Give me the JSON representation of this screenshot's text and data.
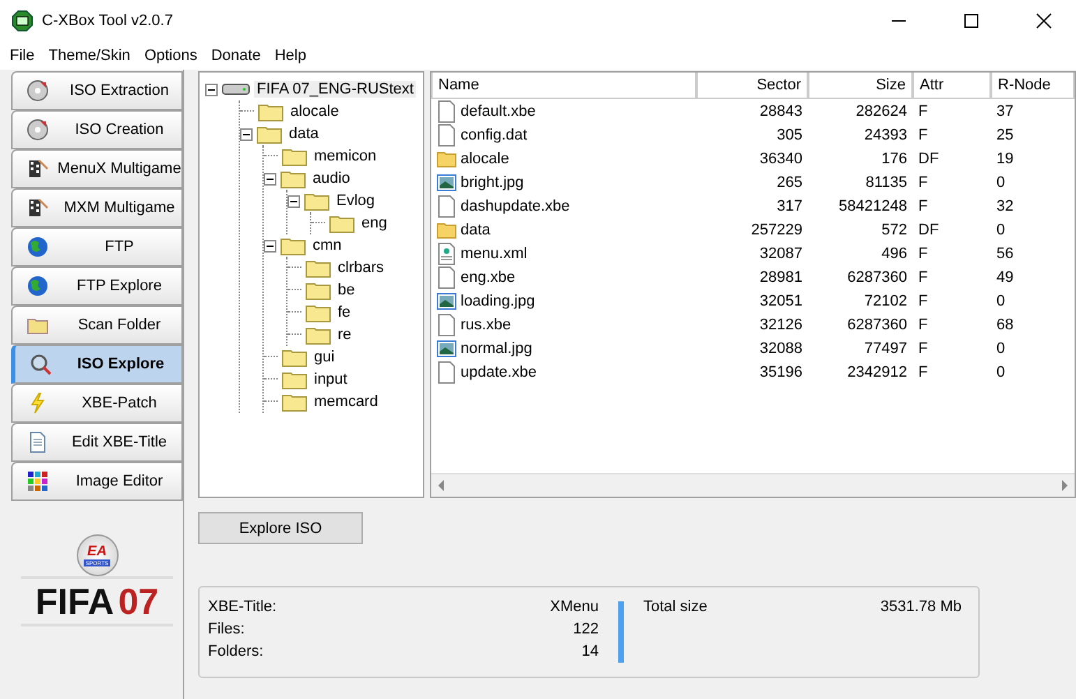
{
  "window": {
    "title": "C-XBox Tool v2.0.7"
  },
  "menu": [
    "File",
    "Theme/Skin",
    "Options",
    "Donate",
    "Help"
  ],
  "sidebar": {
    "items": [
      {
        "label": "ISO Extraction",
        "kind": "disc",
        "selected": false
      },
      {
        "label": "ISO Creation",
        "kind": "disc",
        "selected": false
      },
      {
        "label": "MenuX Multigame",
        "kind": "flag",
        "selected": false
      },
      {
        "label": "MXM Multigame",
        "kind": "flag",
        "selected": false
      },
      {
        "label": "FTP",
        "kind": "globe",
        "selected": false
      },
      {
        "label": "FTP Explore",
        "kind": "globe",
        "selected": false
      },
      {
        "label": "Scan Folder",
        "kind": "folder",
        "selected": false
      },
      {
        "label": "ISO Explore",
        "kind": "search",
        "selected": true
      },
      {
        "label": "XBE-Patch",
        "kind": "bolt",
        "selected": false
      },
      {
        "label": "Edit XBE-Title",
        "kind": "doc",
        "selected": false
      },
      {
        "label": "Image Editor",
        "kind": "palette",
        "selected": false
      }
    ]
  },
  "logo": {
    "badge_top": "EA",
    "badge_bottom": "SPORTS",
    "title": "FIFA",
    "year": "07"
  },
  "tree": {
    "label": "FIFA 07_ENG-RUStext",
    "expanded": true,
    "children": [
      {
        "label": "alocale"
      },
      {
        "label": "data",
        "expanded": true,
        "children": [
          {
            "label": "memicon"
          },
          {
            "label": "audio",
            "expanded": true,
            "children": [
              {
                "label": "Evlog",
                "expanded": true,
                "children": [
                  {
                    "label": "eng"
                  }
                ]
              }
            ]
          },
          {
            "label": "cmn",
            "expanded": true,
            "children": [
              {
                "label": "clrbars"
              },
              {
                "label": "be"
              },
              {
                "label": "fe"
              },
              {
                "label": "re"
              }
            ]
          },
          {
            "label": "gui"
          },
          {
            "label": "input"
          },
          {
            "label": "memcard"
          }
        ]
      }
    ]
  },
  "table": {
    "columns": [
      "Name",
      "Sector",
      "Size",
      "Attr",
      "R-Node"
    ],
    "rows": [
      {
        "kind": "file",
        "cells": [
          "default.xbe",
          "28843",
          "282624",
          "F",
          "37"
        ]
      },
      {
        "kind": "file",
        "cells": [
          "config.dat",
          "305",
          "24393",
          "F",
          "25"
        ]
      },
      {
        "kind": "folder",
        "cells": [
          "alocale",
          "36340",
          "176",
          "DF",
          "19"
        ]
      },
      {
        "kind": "image",
        "cells": [
          "bright.jpg",
          "265",
          "81135",
          "F",
          "0"
        ]
      },
      {
        "kind": "file",
        "cells": [
          "dashupdate.xbe",
          "317",
          "58421248",
          "F",
          "32"
        ]
      },
      {
        "kind": "folder",
        "cells": [
          "data",
          "257229",
          "572",
          "DF",
          "0"
        ]
      },
      {
        "kind": "xml",
        "cells": [
          "menu.xml",
          "32087",
          "496",
          "F",
          "56"
        ]
      },
      {
        "kind": "file",
        "cells": [
          "eng.xbe",
          "28981",
          "6287360",
          "F",
          "49"
        ]
      },
      {
        "kind": "image",
        "cells": [
          "loading.jpg",
          "32051",
          "72102",
          "F",
          "0"
        ]
      },
      {
        "kind": "file",
        "cells": [
          "rus.xbe",
          "32126",
          "6287360",
          "F",
          "68"
        ]
      },
      {
        "kind": "image",
        "cells": [
          "normal.jpg",
          "32088",
          "77497",
          "F",
          "0"
        ]
      },
      {
        "kind": "file",
        "cells": [
          "update.xbe",
          "35196",
          "2342912",
          "F",
          "0"
        ]
      }
    ]
  },
  "explore_button": "Explore ISO",
  "info": {
    "left": [
      {
        "label": "XBE-Title:",
        "value": "XMenu"
      },
      {
        "label": "Files:",
        "value": "122"
      },
      {
        "label": "Folders:",
        "value": "14"
      }
    ],
    "right": [
      {
        "label": "Total size",
        "value": "3531.78 Mb"
      }
    ]
  }
}
